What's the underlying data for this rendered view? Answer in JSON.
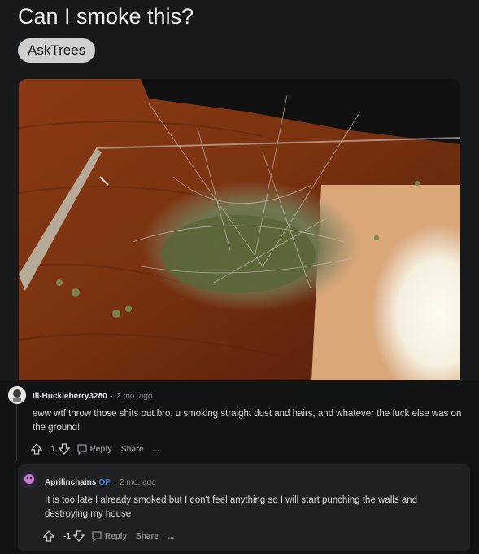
{
  "post": {
    "title": "Can I smoke this?",
    "flair": "AskTrees"
  },
  "comments": [
    {
      "username": "Ill-Huckleberry3280",
      "age": "2 mo. ago",
      "body": "eww wtf throw those shits out bro, u smoking straight dust and hairs, and whatever the fuck else was on the ground!",
      "score": "1",
      "reply_label": "Reply",
      "share_label": "Share",
      "more_label": "..."
    },
    {
      "username": "Aprilinchains",
      "op_badge": "OP",
      "age": "2 mo. ago",
      "body": "It is too late I already smoked but I don't feel anything so I will start punching the walls and destroying my house",
      "score": "-1",
      "reply_label": "Reply",
      "share_label": "Share",
      "more_label": "..."
    }
  ],
  "icons": [
    "upvote-icon",
    "downvote-icon",
    "reply-icon",
    "more-icon",
    "avatar"
  ]
}
